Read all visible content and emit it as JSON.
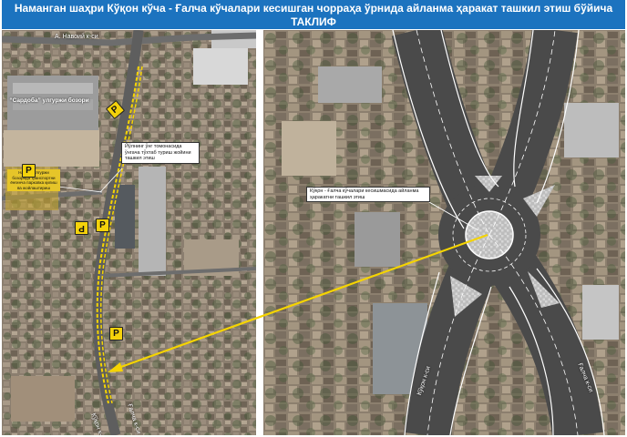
{
  "header": {
    "title_line1": "Наманган шаҳри Кўқон кўча - Ғалча кўчалари кесишган чорраҳа ўрнида айланма ҳаракат ташкил этиш бўйича",
    "title_line2": "ТАКЛИФ"
  },
  "left_map": {
    "street_top": "А. Навоий к-си",
    "market_label": "“Сардоба” улгуржи бозори",
    "callout_left": "Йўлнинг ўнг томонасида ўнгача тўхтаб туриш жойини ташкил этиш",
    "yellow_note": "Навоий улгуржи бозорида транспортни ёнғинча парковка қилиш ва жойлаштириш",
    "street_bottom_left": "Кўқон к-си",
    "street_bottom_right": "Ғалча к-си",
    "parking_sign": "P"
  },
  "right_map": {
    "callout": "Кўқон - Ғалча кўчалари кесишмасида айланма ҳаракатни ташкил этиш",
    "street_left": "Кўқон к-си",
    "street_right": "Ғалча к-си"
  },
  "colors": {
    "header_bg": "#1c73bf",
    "arrow": "#f5d400",
    "road": "#4a4a4a",
    "parking": "#f4d20b"
  }
}
